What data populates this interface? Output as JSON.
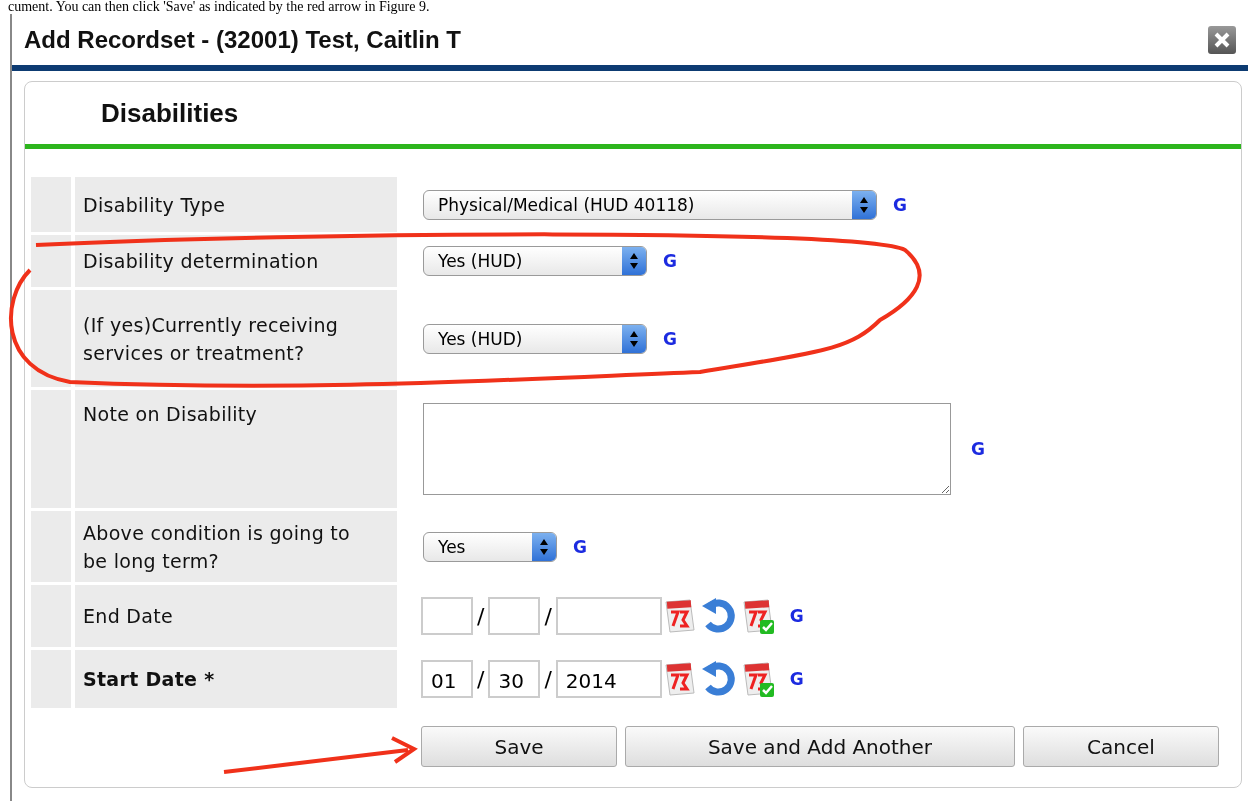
{
  "document_text": "cument.  You can then click 'Save' as indicated by the red arrow in Figure 9.",
  "dialog": {
    "title": "Add Recordset - (32001) Test, Caitlin T",
    "section_title": "Disabilities",
    "fields": [
      {
        "kind": "select",
        "label": "Disability Type",
        "value": "Physical/Medical (HUD 40118)",
        "hint": "G"
      },
      {
        "kind": "select",
        "label": "Disability determination",
        "value": "Yes (HUD)",
        "hint": "G"
      },
      {
        "kind": "select",
        "label": "(If yes)Currently receiving services or treatment?",
        "value": "Yes (HUD)",
        "hint": "G"
      },
      {
        "kind": "textarea",
        "label": "Note on Disability",
        "hint": "G"
      },
      {
        "kind": "select",
        "label": "Above condition is going to be long term?",
        "value": "Yes",
        "hint": "G"
      },
      {
        "kind": "date",
        "label": "End Date",
        "separators": [
          "/",
          "/"
        ],
        "hint": "G",
        "required": false
      },
      {
        "kind": "date",
        "label": "Start Date *",
        "month": "01",
        "day": "30",
        "year": "2014",
        "separators": [
          "/",
          "/"
        ],
        "hint": "G",
        "required": true
      }
    ],
    "buttons": [
      "Save",
      "Save and Add Another",
      "Cancel"
    ]
  }
}
